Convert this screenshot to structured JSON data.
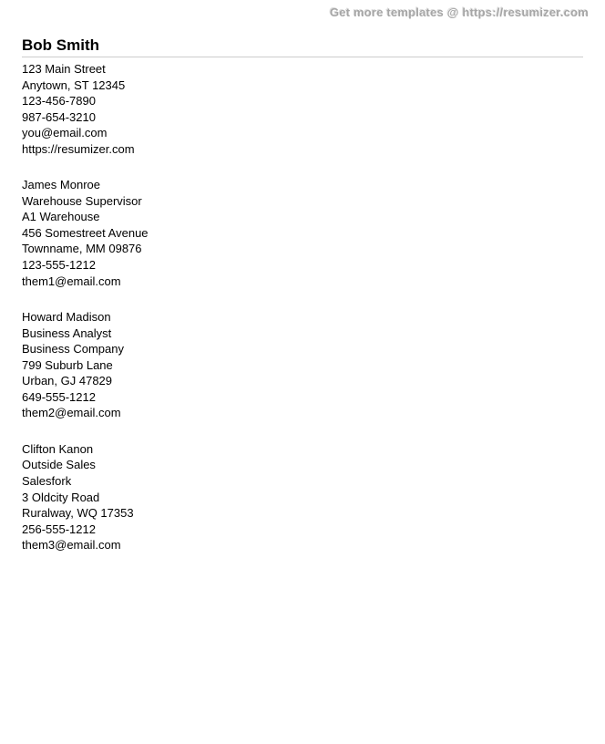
{
  "watermark": "Get more templates @ https://resumizer.com",
  "person": {
    "name": "Bob Smith",
    "address1": "123 Main Street",
    "address2": "Anytown, ST 12345",
    "phone1": "123-456-7890",
    "phone2": "987-654-3210",
    "email": "you@email.com",
    "url": "https://resumizer.com"
  },
  "references": [
    {
      "name": "James Monroe",
      "title": "Warehouse Supervisor",
      "company": "A1 Warehouse",
      "address1": "456 Somestreet Avenue",
      "address2": "Townname, MM 09876",
      "phone": "123-555-1212",
      "email": "them1@email.com"
    },
    {
      "name": "Howard Madison",
      "title": "Business Analyst",
      "company": "Business Company",
      "address1": "799 Suburb Lane",
      "address2": "Urban, GJ 47829",
      "phone": "649-555-1212",
      "email": "them2@email.com"
    },
    {
      "name": "Clifton Kanon",
      "title": "Outside Sales",
      "company": "Salesfork",
      "address1": "3 Oldcity Road",
      "address2": "Ruralway, WQ 17353",
      "phone": "256-555-1212",
      "email": "them3@email.com"
    }
  ]
}
